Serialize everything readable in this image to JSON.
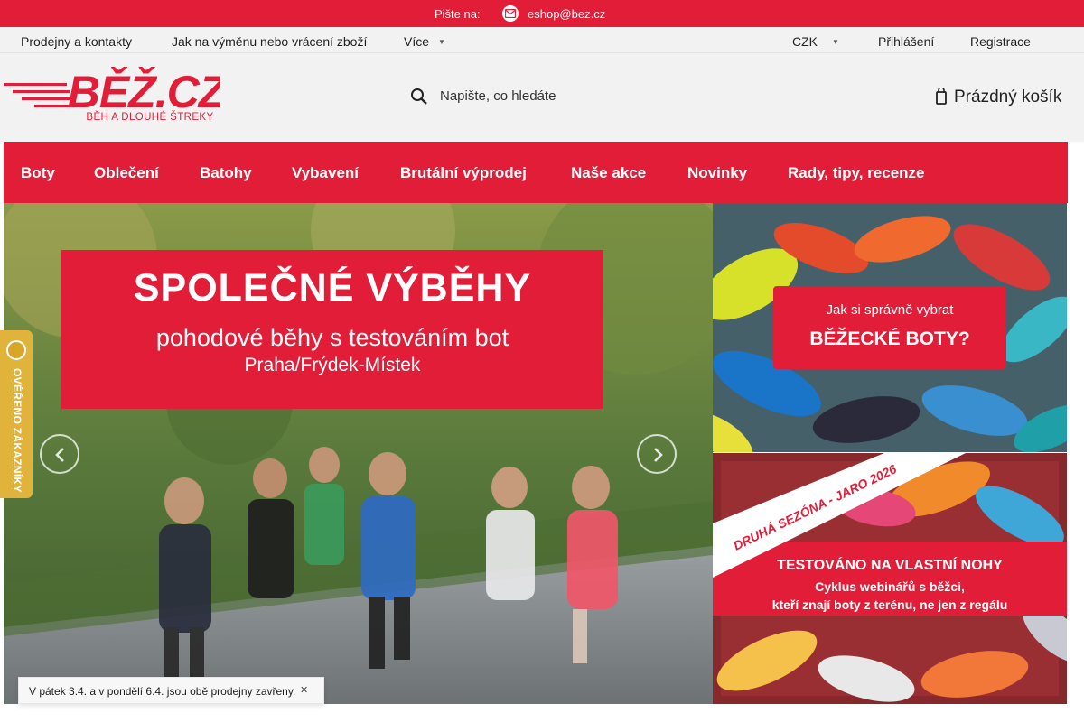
{
  "top_strip": {
    "label": "Pište na:",
    "email": "eshop@bez.cz",
    "icon": "mail-icon",
    "bg": "#e21d38"
  },
  "secondary_nav": {
    "items": [
      "Prodejny a kontakty",
      "Jak na výměnu nebo vrácení zboží",
      "Více"
    ],
    "currency": "CZK",
    "login": "Přihlášení",
    "register": "Registrace"
  },
  "header": {
    "logo_text": "BĚŽ.CZ",
    "logo_tagline": "BĚH A DLOUHÉ ŠTREKY",
    "search_placeholder": "Napište, co hledáte",
    "cart_label": "Prázdný košík"
  },
  "main_nav": {
    "items": [
      "Boty",
      "Oblečení",
      "Batohy",
      "Vybavení",
      "Brutální výprodej",
      "Naše akce",
      "Novinky",
      "Rady, tipy, recenze"
    ]
  },
  "banners": {
    "main": {
      "title": "SPOLEČNÉ VÝBĚHY",
      "subtitle": "pohodové běhy s testováním bot",
      "location": "Praha/Frýdek-Místek"
    },
    "top_right": {
      "line1": "Jak si správně vybrat",
      "line2": "BĚŽECKÉ BOTY?"
    },
    "bottom_right": {
      "ribbon": "DRUHÁ SEZÓNA - JARO 2026",
      "title": "TESTOVÁNO NA VLASTNÍ NOHY",
      "line1": "Cyklus webinářů s běžci,",
      "line2": "kteří znají boty z terénu, ne jen z regálu"
    }
  },
  "verified_badge": {
    "text": "OVĚŘENO ZÁKAZNÍKY"
  },
  "notice": {
    "text": "V pátek 3.4. a v pondělí 6.4. jsou obě prodejny zavřeny."
  },
  "colors": {
    "brand_red": "#e21d38",
    "header_grey": "#f2f2f2",
    "badge_gold": "#e2b33a"
  }
}
